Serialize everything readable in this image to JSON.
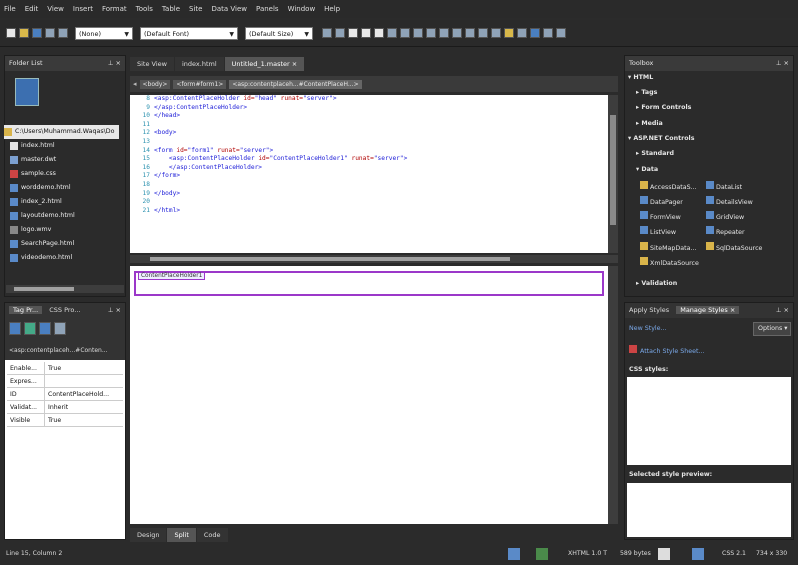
{
  "menubar": [
    "File",
    "Edit",
    "View",
    "Insert",
    "Format",
    "Tools",
    "Table",
    "Site",
    "Data View",
    "Panels",
    "Window",
    "Help"
  ],
  "toolbar": {
    "style_select": "(None)",
    "font_select": "(Default Font)",
    "size_select": "(Default Size)"
  },
  "folder_list": {
    "title": "Folder List",
    "root": "C:\\Users\\Muhammad.Waqas\\Do",
    "files": [
      "index.html",
      "master.dwt",
      "sample.css",
      "worddemo.html",
      "index_2.html",
      "layoutdemo.html",
      "logo.wmv",
      "SearchPage.html",
      "videodemo.html"
    ]
  },
  "tag_panel": {
    "tab1": "Tag Pr...",
    "tab2": "CSS Pro...",
    "path": "<asp:contentplaceh...#Conten...",
    "props": [
      [
        "Enable...",
        "True"
      ],
      [
        "Expres...",
        ""
      ],
      [
        "ID",
        "ContentPlaceHold..."
      ],
      [
        "Validat...",
        "Inherit"
      ],
      [
        "Visible",
        "True"
      ]
    ]
  },
  "doc_tabs": [
    "Site View",
    "index.html",
    "Untitled_1.master"
  ],
  "breadcrumb": [
    "<body>",
    "<form#form1>",
    "<asp:contentplaceh...#ContentPlaceH...>"
  ],
  "code_lines": [
    [
      "8",
      [
        [
          "blue",
          "<asp:ContentPlaceHolder "
        ],
        [
          "red",
          "id="
        ],
        [
          "blue",
          "\"head\" "
        ],
        [
          "red",
          "runat="
        ],
        [
          "blue",
          "\"server\">"
        ]
      ]
    ],
    [
      "9",
      [
        [
          "blue",
          "</asp:ContentPlaceHolder>"
        ]
      ]
    ],
    [
      "10",
      [
        [
          "blue",
          "</head>"
        ]
      ]
    ],
    [
      "11",
      []
    ],
    [
      "12",
      [
        [
          "blue",
          "<body>"
        ]
      ]
    ],
    [
      "13",
      []
    ],
    [
      "14",
      [
        [
          "blue",
          "<form "
        ],
        [
          "red",
          "id="
        ],
        [
          "blue",
          "\"form1\" "
        ],
        [
          "red",
          "runat="
        ],
        [
          "blue",
          "\"server\">"
        ]
      ]
    ],
    [
      "15",
      [
        [
          "blue",
          "    <asp:ContentPlaceHolder "
        ],
        [
          "red",
          "id="
        ],
        [
          "blue",
          "\"ContentPlaceHolder1\" "
        ],
        [
          "red",
          "runat="
        ],
        [
          "blue",
          "\"server\">"
        ]
      ]
    ],
    [
      "16",
      [
        [
          "blue",
          "    </asp:ContentPlaceHolder>"
        ]
      ]
    ],
    [
      "17",
      [
        [
          "blue",
          "</form>"
        ]
      ]
    ],
    [
      "18",
      []
    ],
    [
      "19",
      [
        [
          "blue",
          "</body>"
        ]
      ]
    ],
    [
      "20",
      []
    ],
    [
      "21",
      [
        [
          "blue",
          "</html>"
        ]
      ]
    ]
  ],
  "design_placeholder": "ContentPlaceHolder1",
  "view_tabs": [
    "Design",
    "Split",
    "Code"
  ],
  "toolbox": {
    "title": "Toolbox",
    "html_header": "HTML",
    "html_groups": [
      "Tags",
      "Form Controls",
      "Media"
    ],
    "aspnet_header": "ASP.NET Controls",
    "standard": "Standard",
    "data": "Data",
    "data_items": [
      "AccessDataS...",
      "DataList",
      "DataPager",
      "DetailsView",
      "FormView",
      "GridView",
      "ListView",
      "Repeater",
      "SiteMapData...",
      "SqlDataSource",
      "XmlDataSource"
    ],
    "validation": "Validation"
  },
  "styles_panel": {
    "tab1": "Apply Styles",
    "tab2": "Manage Styles",
    "new_style": "New Style...",
    "attach": "Attach Style Sheet...",
    "options": "Options",
    "css_styles": "CSS styles:",
    "preview": "Selected style preview:"
  },
  "status": {
    "position": "Line 15, Column 2",
    "doctype": "XHTML 1.0 T",
    "size": "589 bytes",
    "css": "CSS 2.1",
    "dims": "734 x 330"
  }
}
